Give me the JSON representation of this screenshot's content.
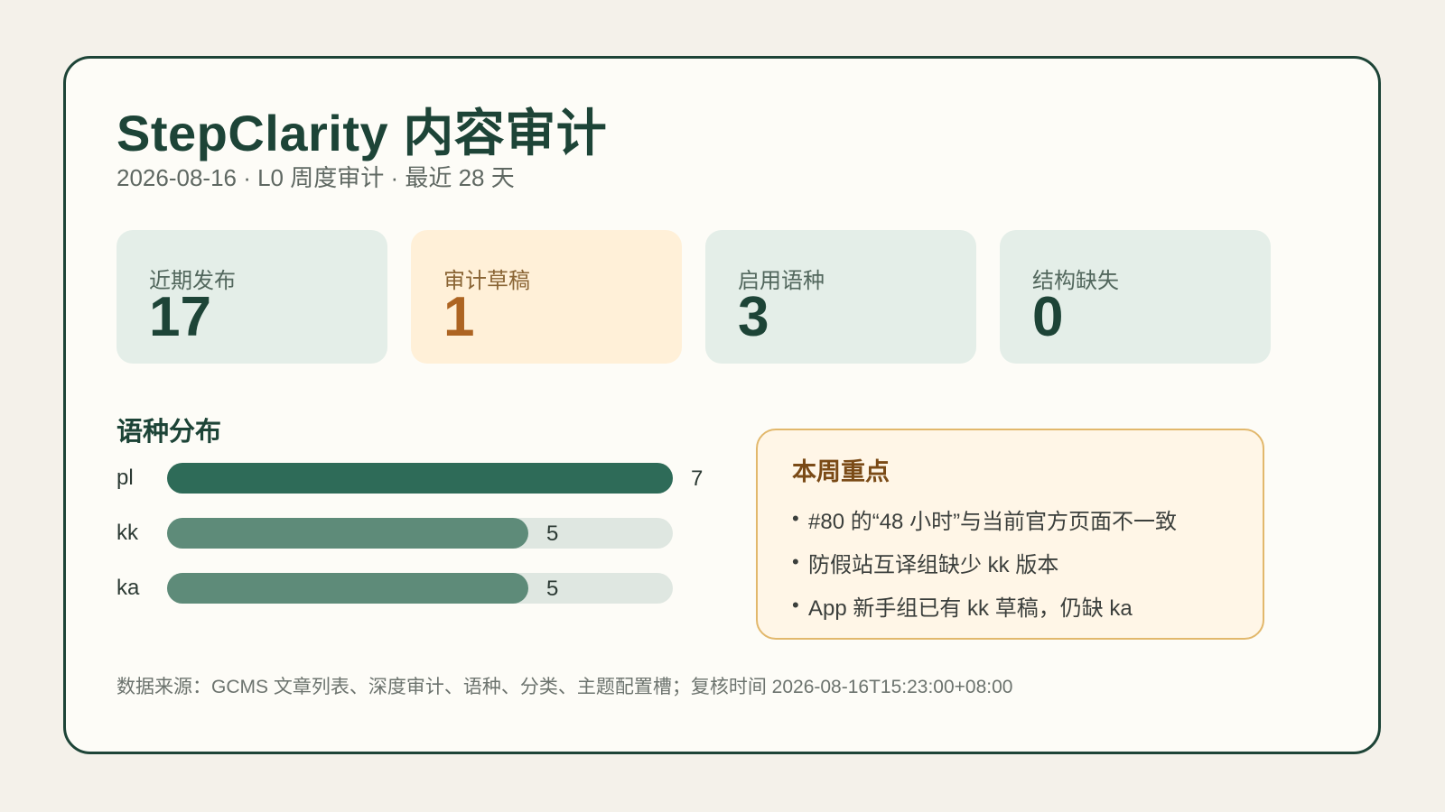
{
  "header": {
    "title": "StepClarity 内容审计",
    "subtitle": "2026-08-16 · L0 周度审计 · 最近 28 天"
  },
  "stats": [
    {
      "label": "近期发布",
      "value": "17"
    },
    {
      "label": "审计草稿",
      "value": "1"
    },
    {
      "label": "启用语种",
      "value": "3"
    },
    {
      "label": "结构缺失",
      "value": "0"
    }
  ],
  "language_distribution": {
    "title": "语种分布",
    "scale_max": 7,
    "items": [
      {
        "lang": "pl",
        "count": 7
      },
      {
        "lang": "kk",
        "count": 5
      },
      {
        "lang": "ka",
        "count": 5
      }
    ]
  },
  "weekly_focus": {
    "title": "本周重点",
    "bullet": "•",
    "items": [
      "#80 的“48 小时”与当前官方页面不一致",
      "防假站互译组缺少 kk 版本",
      "App 新手组已有 kk 草稿，仍缺 ka"
    ]
  },
  "footer": "数据来源：GCMS 文章列表、深度审计、语种、分类、主题配置槽；复核时间 2026-08-16T15:23:00+08:00",
  "colors": {
    "accent_dark": "#1d4437",
    "bar_primary": "#2e6b58",
    "bar_secondary": "#5e8b79",
    "draft_accent": "#ad6422",
    "focus_border": "#e2b86c"
  }
}
